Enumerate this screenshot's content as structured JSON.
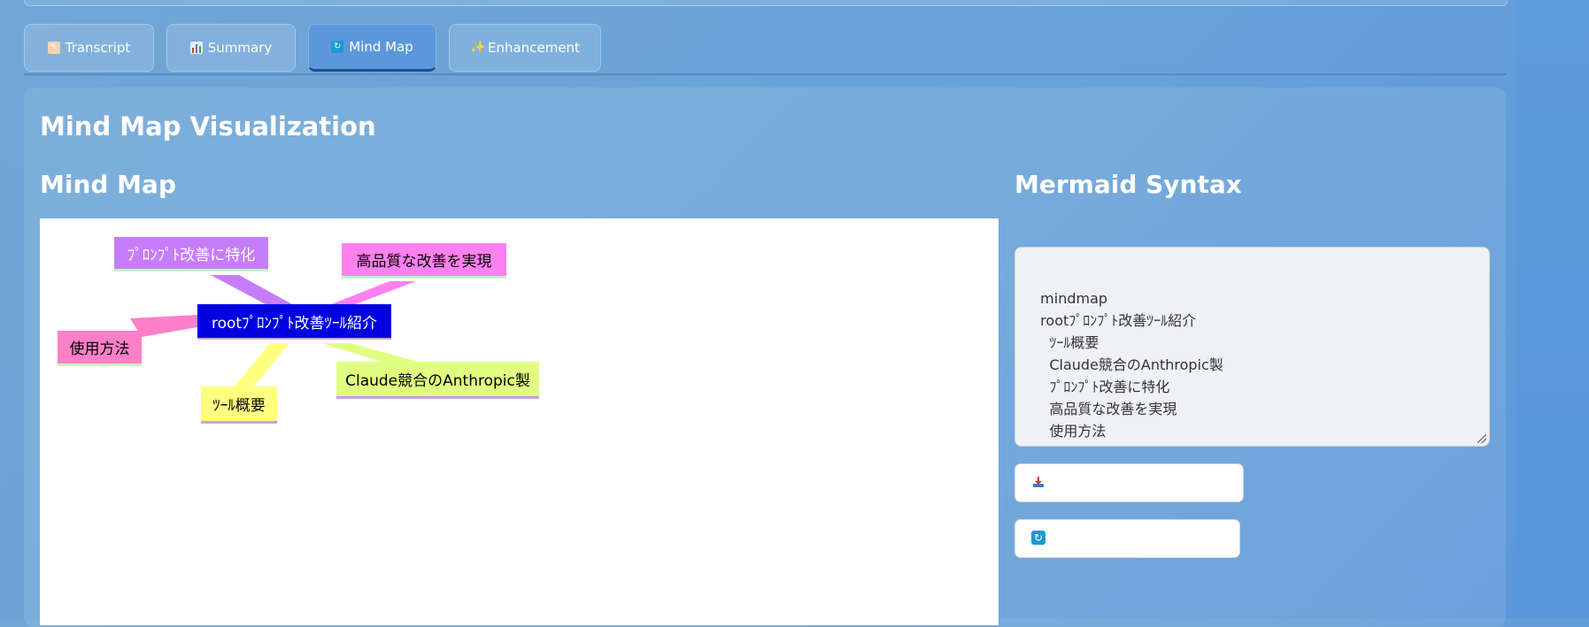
{
  "tabs": [
    {
      "label": "Transcript",
      "icon": "memo-icon"
    },
    {
      "label": "Summary",
      "icon": "bar-chart-icon"
    },
    {
      "label": "Mind Map",
      "icon": "refresh-icon"
    },
    {
      "label": "Enhancement",
      "icon": "sparkles-icon"
    }
  ],
  "active_tab": "Mind Map",
  "section_title": "Mind Map Visualization",
  "mindmap": {
    "title": "Mind Map",
    "root": "rootﾌﾟﾛﾝﾌﾟﾄ改善ﾂｰﾙ紹介",
    "nodes": [
      "ﾌﾟﾛﾝﾌﾟﾄ改善に特化",
      "高品質な改善を実現",
      "使用方法",
      "Claude競合のAnthropic製",
      "ﾂｰﾙ概要"
    ]
  },
  "syntax": {
    "title": "Mermaid Syntax",
    "text": "mindmap\n  rootﾌﾟﾛﾝﾌﾟﾄ改善ﾂｰﾙ紹介\n    ﾂｰﾙ概要\n    Claude競合のAnthropic製\n    ﾌﾟﾛﾝﾌﾟﾄ改善に特化\n    高品質な改善を実現\n    使用方法"
  },
  "buttons": [
    {
      "icon": "download-icon",
      "label": ""
    },
    {
      "icon": "refresh-icon",
      "label": ""
    }
  ],
  "colors": {
    "root": "#0000e0",
    "purple": "#c77dfa",
    "magenta": "#ff80f0",
    "pink": "#ff80c8",
    "lime": "#e0ff80",
    "yellow": "#ffff80"
  }
}
